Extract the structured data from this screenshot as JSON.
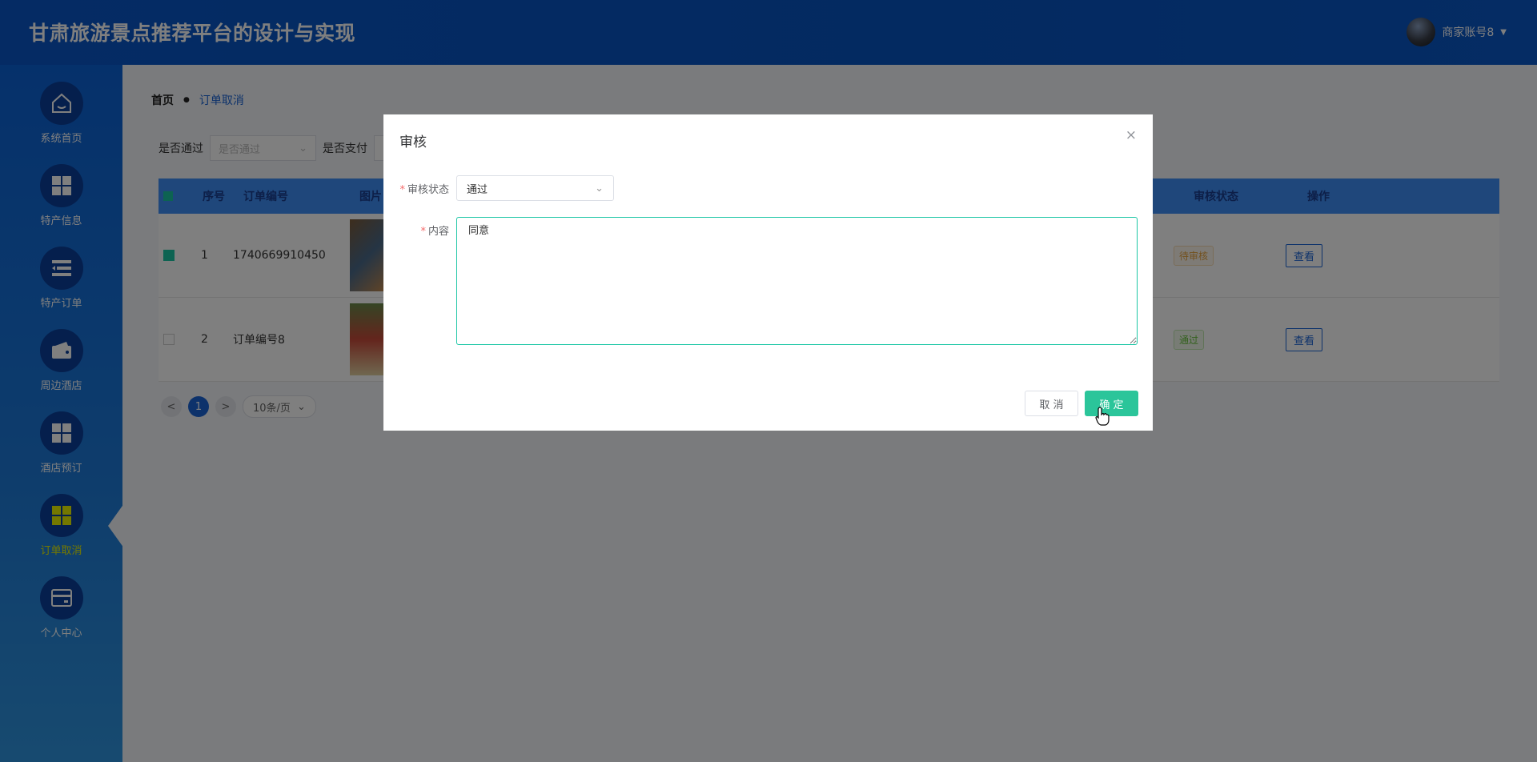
{
  "header": {
    "title": "甘肃旅游景点推荐平台的设计与实现",
    "user_label": "商家账号8"
  },
  "sidebar": {
    "items": [
      {
        "label": "系统首页",
        "icon": "home-icon"
      },
      {
        "label": "特产信息",
        "icon": "grid-icon"
      },
      {
        "label": "特产订单",
        "icon": "list-icon"
      },
      {
        "label": "周边酒店",
        "icon": "wallet-icon"
      },
      {
        "label": "酒店预订",
        "icon": "grid-icon"
      },
      {
        "label": "订单取消",
        "icon": "grid-icon",
        "active": true
      },
      {
        "label": "个人中心",
        "icon": "card-icon"
      }
    ]
  },
  "breadcrumb": {
    "home": "首页",
    "current": "订单取消"
  },
  "filters": {
    "passed_label": "是否通过",
    "passed_placeholder": "是否通过",
    "paid_label": "是否支付"
  },
  "table": {
    "columns": [
      "序号",
      "订单编号",
      "图片",
      "审核状态",
      "操作"
    ],
    "rows": [
      {
        "index": "1",
        "order_no": "1740669910450",
        "status": "待审核",
        "action": "查看",
        "checked": true
      },
      {
        "index": "2",
        "order_no": "订单编号8",
        "status": "通过",
        "action": "查看",
        "checked": false
      }
    ]
  },
  "pager": {
    "prev": "<",
    "page": "1",
    "next": ">",
    "page_size": "10条/页"
  },
  "dialog": {
    "title": "审核",
    "close": "×",
    "status_label": "审核状态",
    "status_value": "通过",
    "content_label": "内容",
    "content_value": "同意",
    "cancel_label": "取 消",
    "confirm_label": "确 定"
  },
  "colors": {
    "header_bg": "#0754c2",
    "accent_green": "#2bc59a",
    "active_nav": "#e8f000"
  }
}
